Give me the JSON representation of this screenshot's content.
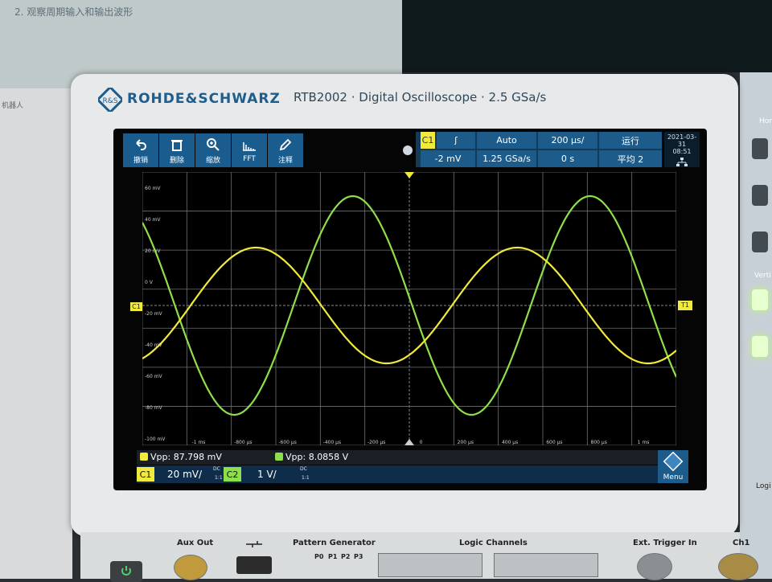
{
  "background": {
    "monitor_text": "2. 观察周期输入和输出波形",
    "left_text": "机器人"
  },
  "brand": {
    "name": "ROHDE&SCHWARZ",
    "model_line": "RTB2002 · Digital Oscilloscope · 2.5 GSa/s"
  },
  "toolbar": {
    "undo": "撤销",
    "delete": "删除",
    "zoom": "缩放",
    "fft": "FFT",
    "annotate": "注释"
  },
  "status": {
    "trigger_source": "C1",
    "trigger_slope": "ʃ",
    "mode": "Auto",
    "timebase": "200 µs/",
    "run": "运行",
    "level": "-2 mV",
    "sample_rate": "1.25 GSa/s",
    "position": "0 s",
    "average": "平均 2"
  },
  "datetime": {
    "date": "2021-03-31",
    "time": "08:51"
  },
  "axis": {
    "y_labels": [
      "60 mV",
      "40 mV",
      "20 mV",
      "0 V",
      "-20 mV",
      "-40 mV",
      "-60 mV",
      "-80 mV",
      "-100 mV"
    ],
    "x_labels": [
      "-1 ms",
      "-800 µs",
      "-600 µs",
      "-400 µs",
      "-200 µs",
      "0",
      "200 µs",
      "400 µs",
      "600 µs",
      "800 µs",
      "1 ms"
    ],
    "left_marker": "C1",
    "right_marker": "T1"
  },
  "measurements": {
    "c1": {
      "badge": "C1",
      "text": "Vpp: 87.798 mV"
    },
    "c2": {
      "badge": "C2",
      "text": "Vpp: 8.0858 V"
    }
  },
  "channels": {
    "c1": {
      "label": "C1",
      "scale": "20 mV/",
      "coupling": "DC",
      "probe": "1:1"
    },
    "c2": {
      "label": "C2",
      "scale": "1 V/",
      "coupling": "DC",
      "probe": "1:1"
    }
  },
  "menu_label": "Menu",
  "colors": {
    "ch1": "#f2ea3b",
    "ch2": "#8ee04a",
    "accent": "#1d5b8a",
    "grid": "#6f6f6f"
  },
  "lower_panel": {
    "aux_out": "Aux Out",
    "pattern_generator": "Pattern Generator",
    "pattern_pins": [
      "P0",
      "P1",
      "P2",
      "P3"
    ],
    "logic_channels": "Logic Channels",
    "ext_trigger": "Ext. Trigger In",
    "ch1": "Ch1"
  },
  "side_panel": {
    "top": "Hor",
    "vertical": "Verti",
    "logic": "Logi"
  }
}
